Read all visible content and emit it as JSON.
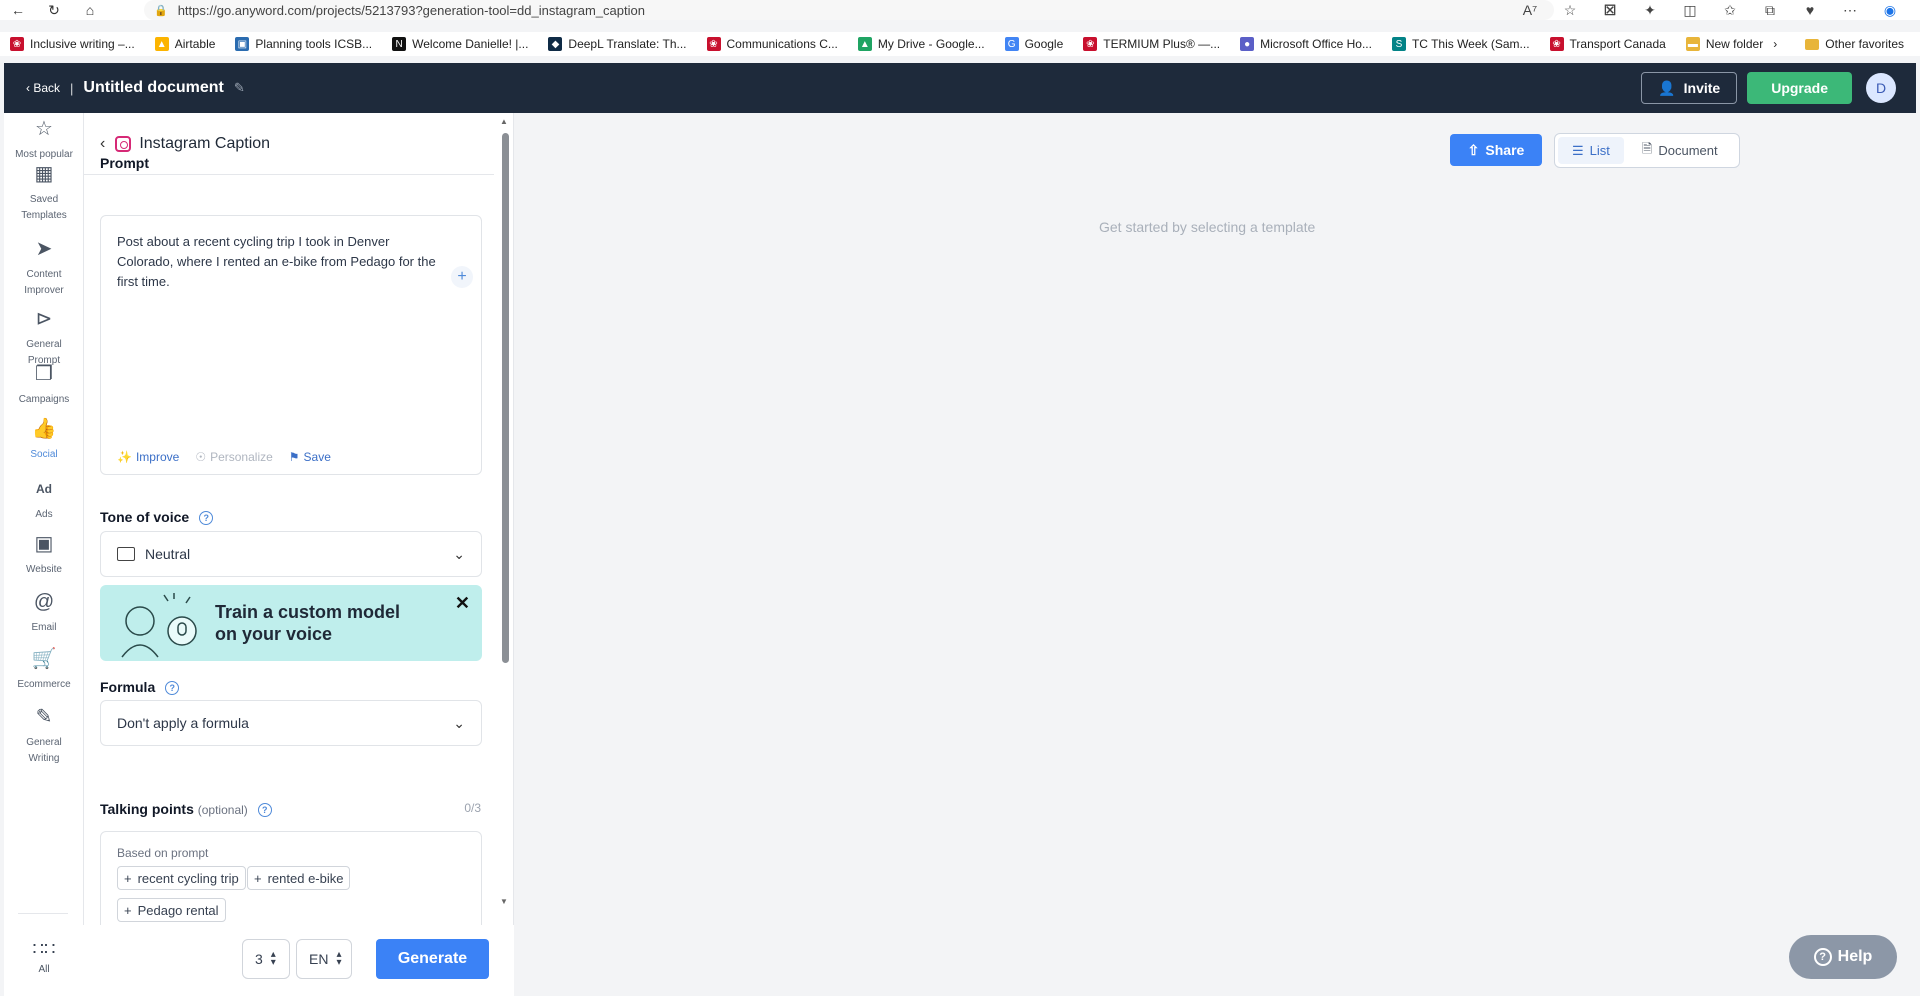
{
  "browser": {
    "url": "https://go.anyword.com/projects/5213793?generation-tool=dd_instagram_caption",
    "bookmarks": [
      {
        "label": "Inclusive writing –...",
        "icon": "maple-leaf-icon",
        "color": "#c8102e"
      },
      {
        "label": "Airtable",
        "icon": "airtable-icon",
        "color": "#fcb400"
      },
      {
        "label": "Planning tools ICSB...",
        "icon": "planning-icon",
        "color": "#2b6cb0"
      },
      {
        "label": "Welcome Danielle! |...",
        "icon": "notion-icon",
        "color": "#111111"
      },
      {
        "label": "DeepL Translate: Th...",
        "icon": "deepl-icon",
        "color": "#0f2b46"
      },
      {
        "label": "Communications C...",
        "icon": "maple-leaf-icon",
        "color": "#c8102e"
      },
      {
        "label": "My Drive - Google...",
        "icon": "drive-icon",
        "color": "#1fa463"
      },
      {
        "label": "Google",
        "icon": "google-icon",
        "color": "#4285f4"
      },
      {
        "label": "TERMIUM Plus® —...",
        "icon": "maple-leaf-icon",
        "color": "#c8102e"
      },
      {
        "label": "Microsoft Office Ho...",
        "icon": "office-icon",
        "color": "#5b5fc7"
      },
      {
        "label": "TC This Week (Sam...",
        "icon": "sharepoint-icon",
        "color": "#038387"
      },
      {
        "label": "Transport Canada",
        "icon": "maple-leaf-icon",
        "color": "#c8102e"
      },
      {
        "label": "New folder",
        "icon": "folder-icon",
        "color": "#e8b53a"
      }
    ],
    "other_favorites": "Other favorites"
  },
  "header": {
    "back_label": "Back",
    "doc_title": "Untitled document",
    "invite_label": "Invite",
    "upgrade_label": "Upgrade",
    "avatar_initial": "D"
  },
  "rail": {
    "items": [
      {
        "label": "Most popular",
        "icon": "star-icon"
      },
      {
        "label": "Saved Templates",
        "icon": "saved-templates-icon"
      },
      {
        "label": "Content Improver",
        "icon": "rocket-icon"
      },
      {
        "label": "General Prompt",
        "icon": "terminal-icon"
      },
      {
        "label": "Campaigns",
        "icon": "campaigns-icon"
      },
      {
        "label": "Social",
        "icon": "thumbs-up-icon"
      },
      {
        "label": "Ads",
        "icon": "ad-icon"
      },
      {
        "label": "Website",
        "icon": "browser-window-icon"
      },
      {
        "label": "Email",
        "icon": "at-sign-icon"
      },
      {
        "label": "Ecommerce",
        "icon": "cart-icon"
      },
      {
        "label": "General Writing",
        "icon": "pen-icon"
      }
    ],
    "all_label": "All"
  },
  "panel": {
    "title": "Instagram Caption",
    "prompt_label": "Prompt",
    "prompt_text": "Post about a recent cycling trip I took in Denver Colorado, where I rented an e-bike from Pedago for the first time.",
    "improve_label": "Improve",
    "personalize_label": "Personalize",
    "save_label": "Save",
    "tone_label": "Tone of voice",
    "tone_value": "Neutral",
    "promo_text_line1": "Train a custom model",
    "promo_text_line2": "on your voice",
    "formula_label": "Formula",
    "formula_value": "Don't apply a formula",
    "talking_points_label": "Talking points",
    "talking_points_optional": "(optional)",
    "talking_points_counter": "0/3",
    "talking_points_caption": "Based on prompt",
    "chips": [
      "recent cycling trip",
      "rented e-bike",
      "Pedago rental"
    ]
  },
  "footer": {
    "count_value": "3",
    "language_value": "EN",
    "generate_label": "Generate"
  },
  "main": {
    "share_label": "Share",
    "list_label": "List",
    "document_label": "Document",
    "empty_message": "Get started by selecting a template",
    "help_label": "Help"
  },
  "colors": {
    "header_bg": "#1e2a3b",
    "upgrade_green": "#3cb878",
    "primary_blue": "#3b82f6",
    "promo_teal": "#bfeeec",
    "help_gray": "#8c97a7"
  }
}
